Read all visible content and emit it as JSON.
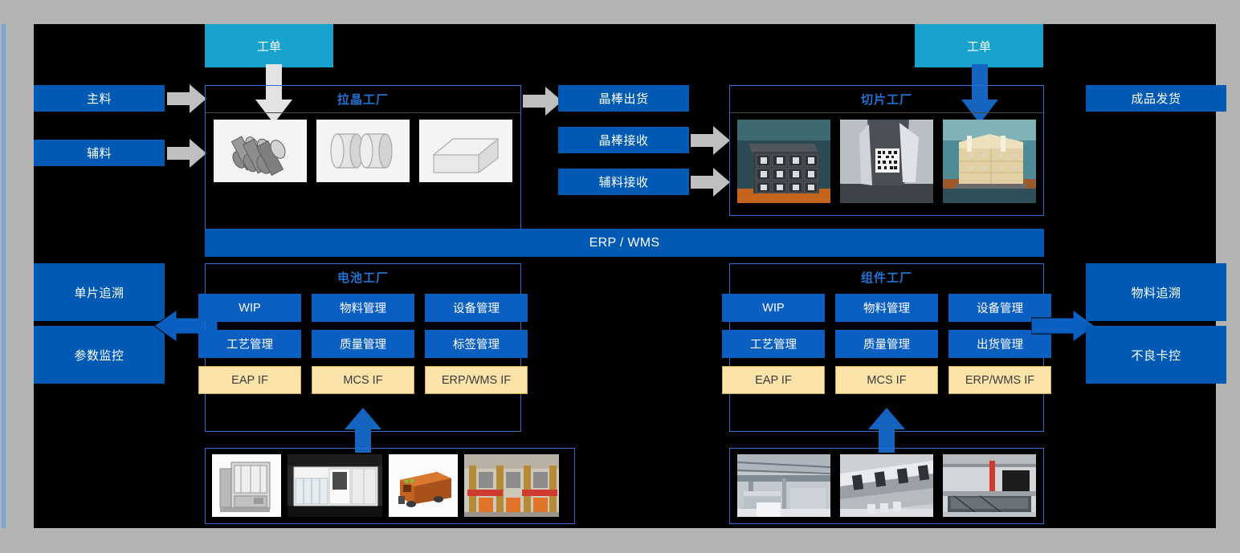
{
  "colors": {
    "canvas_bg": "#000000",
    "page_bg": "#b3b3b3",
    "blue": "#0059b3",
    "module_blue": "#0b5fc0",
    "cyan": "#17a3cd",
    "yellow_if": "#fbe3a9",
    "panel_border": "#2d6fd0",
    "title_blue": "#1f74d6",
    "gray_arrow": "#bfbfbf",
    "blue_arrow": "#1565c0",
    "left_strip": "#7ba7d7"
  },
  "work_orders": [
    {
      "label": "工单",
      "arrow": "gray"
    },
    {
      "label": "工单",
      "arrow": "blue"
    }
  ],
  "inputs": [
    {
      "label": "主料"
    },
    {
      "label": "辅料"
    }
  ],
  "middle_flow": [
    {
      "label": "晶棒出货",
      "arrow": "incoming-left"
    },
    {
      "label": "晶棒接收",
      "arrow": "outgoing-right"
    },
    {
      "label": "辅料接收",
      "arrow": "outgoing-right"
    }
  ],
  "right_top": [
    {
      "label": "成品发货"
    }
  ],
  "left_outputs": [
    {
      "label": "单片追溯"
    },
    {
      "label": "参数监控"
    }
  ],
  "right_outputs": [
    {
      "label": "物料追溯"
    },
    {
      "label": "不良卡控"
    }
  ],
  "integration_bar": {
    "label": "ERP / WMS"
  },
  "factories": {
    "crystal": {
      "title": "拉晶工厂",
      "photos": [
        "ingot-rods-photo",
        "wafer-cylinders-photo",
        "crate-box-photo"
      ]
    },
    "slicing": {
      "title": "切片工厂",
      "photos": [
        "stacked-bricks-photo",
        "qr-code-brick-photo",
        "palletized-cartons-photo"
      ]
    },
    "cell": {
      "title": "电池工厂",
      "modules": [
        {
          "label": "WIP",
          "kind": "module"
        },
        {
          "label": "物料管理",
          "kind": "module"
        },
        {
          "label": "设备管理",
          "kind": "module"
        },
        {
          "label": "工艺管理",
          "kind": "module"
        },
        {
          "label": "质量管理",
          "kind": "module"
        },
        {
          "label": "标签管理",
          "kind": "module"
        },
        {
          "label": "EAP IF",
          "kind": "interface"
        },
        {
          "label": "MCS IF",
          "kind": "interface"
        },
        {
          "label": "ERP/WMS IF",
          "kind": "interface"
        }
      ],
      "equipment_photos": [
        "cell-furnace-photo",
        "cell-production-line-photo",
        "agv-cart-photo",
        "cell-warehouse-photo"
      ]
    },
    "module": {
      "title": "组件工厂",
      "modules": [
        {
          "label": "WIP",
          "kind": "module"
        },
        {
          "label": "物料管理",
          "kind": "module"
        },
        {
          "label": "设备管理",
          "kind": "module"
        },
        {
          "label": "工艺管理",
          "kind": "module"
        },
        {
          "label": "质量管理",
          "kind": "module"
        },
        {
          "label": "出货管理",
          "kind": "module"
        },
        {
          "label": "EAP IF",
          "kind": "interface"
        },
        {
          "label": "MCS IF",
          "kind": "interface"
        },
        {
          "label": "ERP/WMS IF",
          "kind": "interface"
        }
      ],
      "equipment_photos": [
        "module-workshop-photo",
        "module-stringer-photo",
        "module-laminator-photo"
      ]
    }
  }
}
